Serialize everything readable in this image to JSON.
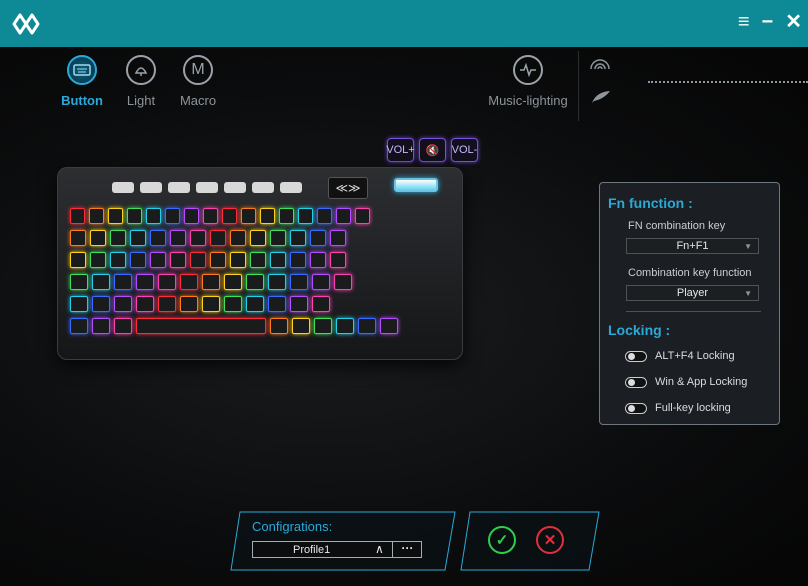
{
  "titlebar": {
    "menu_label": "≡",
    "minimize_label": "−",
    "close_label": "✕"
  },
  "nav": {
    "button_label": "Button",
    "light_label": "Light",
    "macro_label": "Macro",
    "macro_icon_text": "M",
    "music_label": "Music-lighting"
  },
  "media_keys": [
    "VOL+",
    "mute",
    "VOL-"
  ],
  "fn_panel": {
    "title": "Fn function :",
    "combo_label": "FN combination key",
    "combo_value": "Fn+F1",
    "function_label": "Combination key function",
    "function_value": "Player",
    "locking_title": "Locking :",
    "locks": [
      {
        "label": "ALT+F4 Locking"
      },
      {
        "label": "Win & App Locking"
      },
      {
        "label": "Full-key locking"
      }
    ]
  },
  "configurations": {
    "label": "Configrations:",
    "profile_value": "Profile1",
    "more_label": "···"
  },
  "colors": {
    "accent": "#2aa9d8",
    "titlebar": "#0e8a96",
    "confirm": "#2fcf4e",
    "cancel": "#e0303e"
  }
}
